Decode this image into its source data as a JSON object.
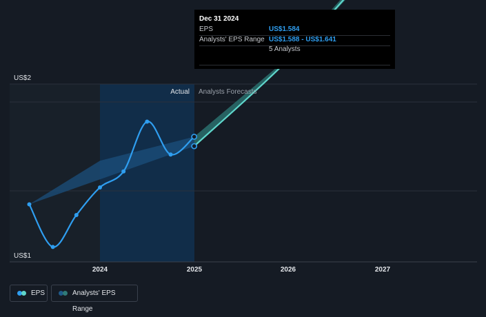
{
  "tooltip": {
    "date": "Dec 31 2024",
    "eps_label": "EPS",
    "eps_value": "US$1.584",
    "range_label": "Analysts' EPS Range",
    "range_value": "US$1.588 - US$1.641",
    "analysts": "5 Analysts"
  },
  "legend": {
    "eps": "EPS",
    "range": "Analysts' EPS Range"
  },
  "colors": {
    "actual": "#2f9ef0",
    "forecast": "#5fd6cb",
    "range_actual": "#1b4f7c",
    "range_forecast": "#2a6e6d",
    "highlight": "#10304f"
  },
  "chart_data": {
    "type": "line",
    "xlabel": "",
    "ylabel": "",
    "x_ticks": [
      "2024",
      "2025",
      "2026",
      "2027"
    ],
    "y_ticks": [
      "US$1",
      "US$2"
    ],
    "ylim": [
      1.0,
      2.0
    ],
    "section_labels": {
      "actual": "Actual",
      "forecast": "Analysts Forecasts"
    },
    "series": [
      {
        "name": "EPS",
        "kind": "actual",
        "points": [
          {
            "x": 2023.25,
            "y": 1.285
          },
          {
            "x": 2023.5,
            "y": 1.045
          },
          {
            "x": 2023.75,
            "y": 1.225
          },
          {
            "x": 2024.0,
            "y": 1.38
          },
          {
            "x": 2024.25,
            "y": 1.47
          },
          {
            "x": 2024.5,
            "y": 1.75
          },
          {
            "x": 2024.75,
            "y": 1.565
          },
          {
            "x": 2025.0,
            "y": 1.665
          }
        ]
      },
      {
        "name": "EPS",
        "kind": "forecast",
        "points": [
          {
            "x": 2025.0,
            "y": 1.612
          },
          {
            "x": 2026.0,
            "y": 2.1
          },
          {
            "x": 2027.0,
            "y": 2.68
          },
          {
            "x": 2028.0,
            "y": 3.25
          }
        ]
      },
      {
        "name": "Analysts' EPS Range",
        "kind": "range",
        "low": [
          {
            "x": 2023.25,
            "y": 1.285
          },
          {
            "x": 2025.0,
            "y": 1.612
          },
          {
            "x": 2026.0,
            "y": 2.09
          },
          {
            "x": 2027.0,
            "y": 2.66
          },
          {
            "x": 2028.0,
            "y": 3.2
          }
        ],
        "high": [
          {
            "x": 2023.25,
            "y": 1.285
          },
          {
            "x": 2024.0,
            "y": 1.53
          },
          {
            "x": 2025.0,
            "y": 1.665
          },
          {
            "x": 2026.0,
            "y": 2.11
          },
          {
            "x": 2027.0,
            "y": 2.7
          },
          {
            "x": 2028.0,
            "y": 3.35
          }
        ]
      }
    ]
  }
}
